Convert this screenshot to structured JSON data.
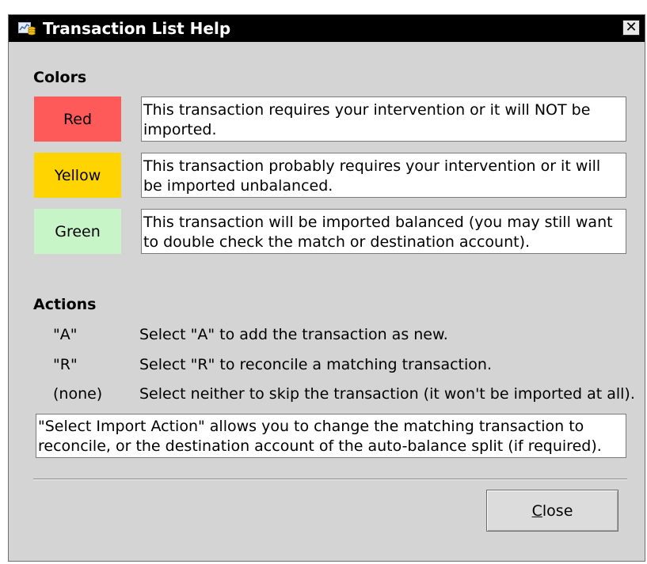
{
  "window": {
    "title": "Transaction List Help"
  },
  "colors_section": {
    "heading": "Colors",
    "items": [
      {
        "label": "Red",
        "color": "#ff5a5a",
        "description": "This transaction requires your intervention or it will NOT be imported."
      },
      {
        "label": "Yellow",
        "color": "#ffd400",
        "description": "This transaction probably requires your intervention or it will be imported unbalanced."
      },
      {
        "label": "Green",
        "color": "#c8f5c8",
        "description": "This transaction will be imported balanced (you may still want to double check the match or destination account)."
      }
    ]
  },
  "actions_section": {
    "heading": "Actions",
    "items": [
      {
        "key": "\"A\"",
        "text": "Select \"A\" to add the transaction as new."
      },
      {
        "key": "\"R\"",
        "text": "Select \"R\" to reconcile a matching transaction."
      },
      {
        "key": "(none)",
        "text": "Select neither to skip the transaction (it won't be imported at all)."
      }
    ],
    "note": "\"Select Import Action\" allows you to change the matching transaction to reconcile, or the destination account of the auto-balance split (if required)."
  },
  "buttons": {
    "close_label_first": "C",
    "close_label_rest": "lose"
  },
  "icons": {
    "app": "app-icon",
    "close": "close-icon"
  }
}
